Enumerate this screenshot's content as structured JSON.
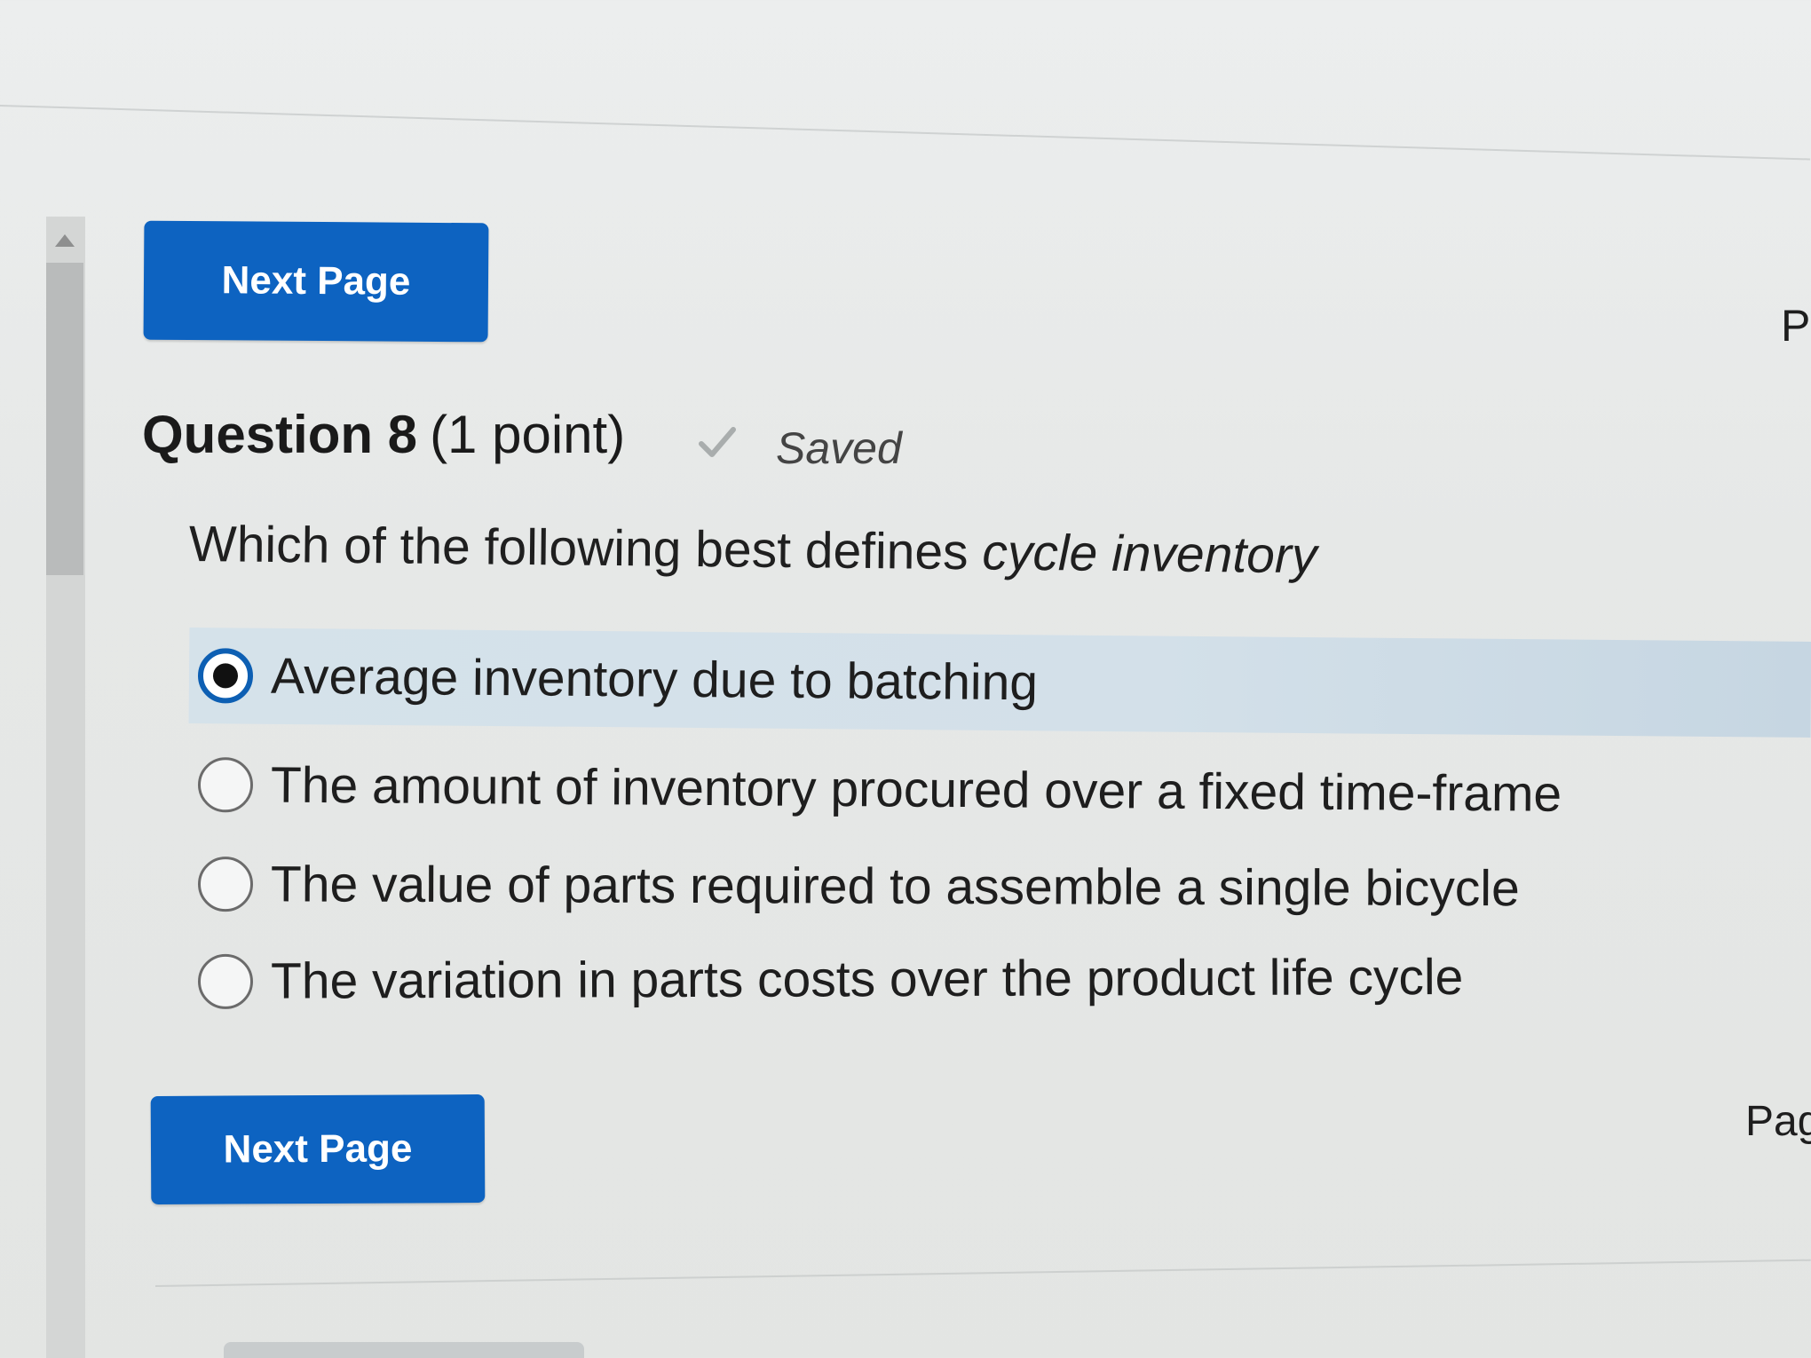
{
  "nav": {
    "next_page_label": "Next Page",
    "page_indicator_top": "P",
    "page_indicator_bottom": "Pag"
  },
  "question": {
    "title": "Question 8",
    "points": "(1 point)",
    "status": "Saved",
    "prompt_plain": "Which of the following best defines ",
    "prompt_emphasis": "cycle inventory"
  },
  "options": [
    {
      "label": "Average inventory due to batching",
      "selected": true
    },
    {
      "label": "The amount of inventory procured over a fixed time-frame",
      "selected": false
    },
    {
      "label": "The value of parts required to assemble a single bicycle",
      "selected": false
    },
    {
      "label": "The variation in parts costs over the product life cycle",
      "selected": false
    }
  ],
  "colors": {
    "button": "#0d63c1",
    "selected_row": "#d5e2ea",
    "radio_selected_ring": "#0d5fb3"
  },
  "icons": {
    "saved": "checkmark-icon",
    "scroll_up": "caret-up-icon"
  }
}
